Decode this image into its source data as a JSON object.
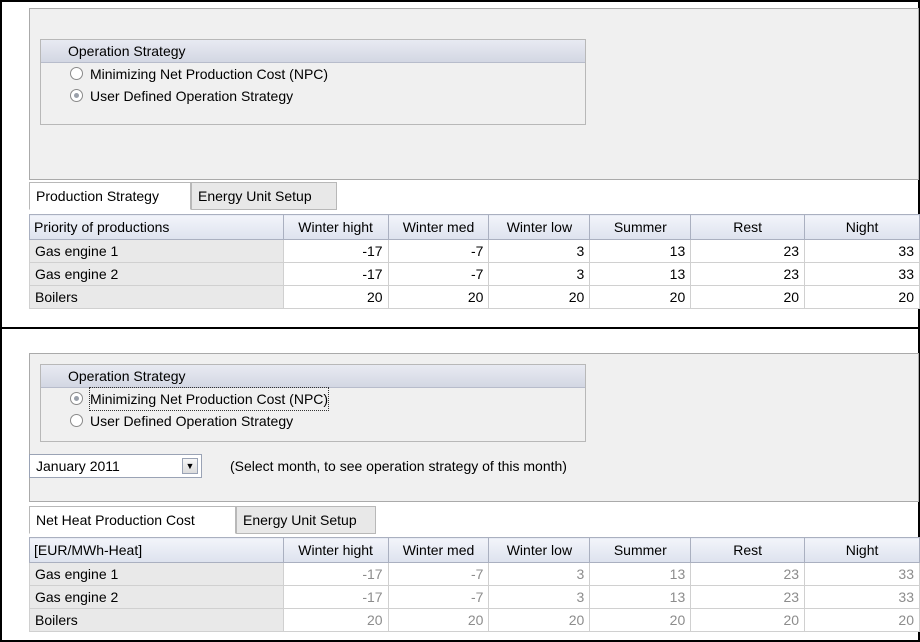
{
  "top_panel": {
    "group_title": "Operation Strategy",
    "radios": [
      {
        "label": "Minimizing Net Production Cost (NPC)",
        "checked": false
      },
      {
        "label": "User Defined Operation Strategy",
        "checked": true
      }
    ],
    "tabs": [
      {
        "label": "Production Strategy",
        "active": true
      },
      {
        "label": "Energy Unit Setup",
        "active": false
      }
    ],
    "table": {
      "headers": [
        "Priority of productions",
        "Winter hight",
        "Winter med",
        "Winter low",
        "Summer",
        "Rest",
        "Night"
      ],
      "rows": [
        {
          "name": "Gas engine 1",
          "values": [
            "-17",
            "-7",
            "3",
            "13",
            "23",
            "33"
          ]
        },
        {
          "name": "Gas engine 2",
          "values": [
            "-17",
            "-7",
            "3",
            "13",
            "23",
            "33"
          ]
        },
        {
          "name": "Boilers",
          "values": [
            "20",
            "20",
            "20",
            "20",
            "20",
            "20"
          ]
        }
      ]
    }
  },
  "bottom_panel": {
    "group_title": "Operation Strategy",
    "radios": [
      {
        "label": "Minimizing Net Production Cost (NPC)",
        "checked": true
      },
      {
        "label": "User Defined Operation Strategy",
        "checked": false
      }
    ],
    "month_select": {
      "value": "January 2011",
      "icon": "chevron-down-icon"
    },
    "hint": "(Select month, to see operation strategy of this month)",
    "tabs": [
      {
        "label": "Net Heat Production Cost",
        "active": true
      },
      {
        "label": "Energy Unit Setup",
        "active": false
      }
    ],
    "table": {
      "headers": [
        "[EUR/MWh-Heat]",
        "Winter hight",
        "Winter med",
        "Winter low",
        "Summer",
        "Rest",
        "Night"
      ],
      "rows": [
        {
          "name": "Gas engine 1",
          "values": [
            "-17",
            "-7",
            "3",
            "13",
            "23",
            "33"
          ]
        },
        {
          "name": "Gas engine 2",
          "values": [
            "-17",
            "-7",
            "3",
            "13",
            "23",
            "33"
          ]
        },
        {
          "name": "Boilers",
          "values": [
            "20",
            "20",
            "20",
            "20",
            "20",
            "20"
          ]
        }
      ]
    }
  }
}
